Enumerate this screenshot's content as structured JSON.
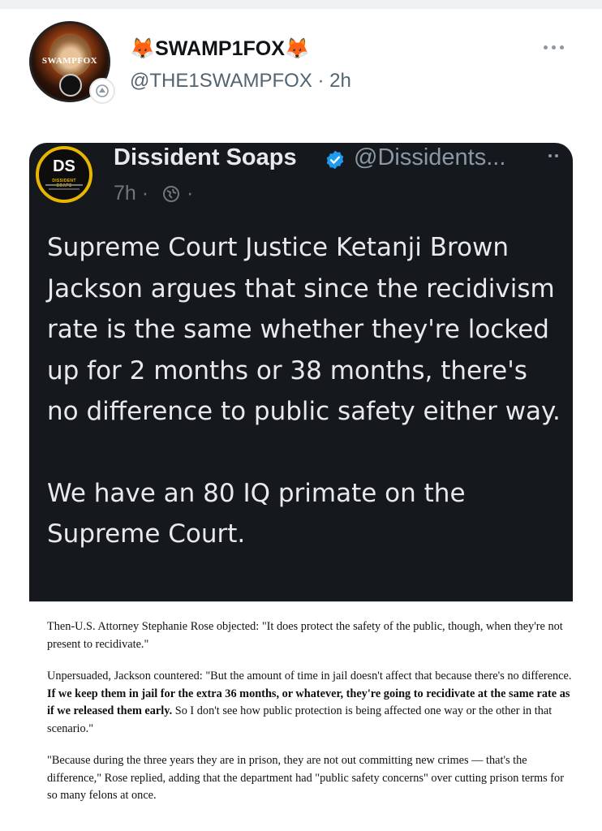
{
  "post": {
    "display_name": "🦊SWAMP1FOX🦊",
    "handle_time": "@THE1SWAMPFOX · 2h",
    "avatar_text": "SWAMPFOX"
  },
  "quoted": {
    "name": "Dissident Soaps",
    "handle": "@Dissidents...",
    "time": "7h ·",
    "dot": "·",
    "logo_text": "DS",
    "logo_sub": "DISSIDENT SOAPS",
    "paragraph1": "Supreme Court Justice Ketanji Brown Jackson argues that since the recidivism rate is the same whether they're locked up for 2 months or 38 months, there's no difference to public safety either way.",
    "paragraph2": "We have an 80 IQ primate on the Supreme Court."
  },
  "article": {
    "p1": "Then-U.S. Attorney Stephanie Rose objected: \"It does protect the safety of the public, though, when they're not present to recidivate.\"",
    "p2_start": "Unpersuaded, Jackson countered: \"But the amount of time in jail doesn't affect that because there's no difference. ",
    "p2_bold": "If we keep them in jail for the extra 36 months, or whatever, they're going to recidivate at the same rate as if we released them early.",
    "p2_end": " So I don't see how public protection is being affected one way or the other in that scenario.\"",
    "p3": "\"Because during the three years they are in prison, they are not out committing new crimes — that's the difference,\" Rose replied, adding that the department had \"public safety concerns\" over cutting prison terms for so many felons at once."
  },
  "colors": {
    "card_bg": "#15181c",
    "verified_blue": "#1d9bf0",
    "logo_gold": "#e8b500"
  },
  "icons": [
    "more-icon",
    "verified-icon",
    "globe-icon",
    "badge-icon"
  ]
}
